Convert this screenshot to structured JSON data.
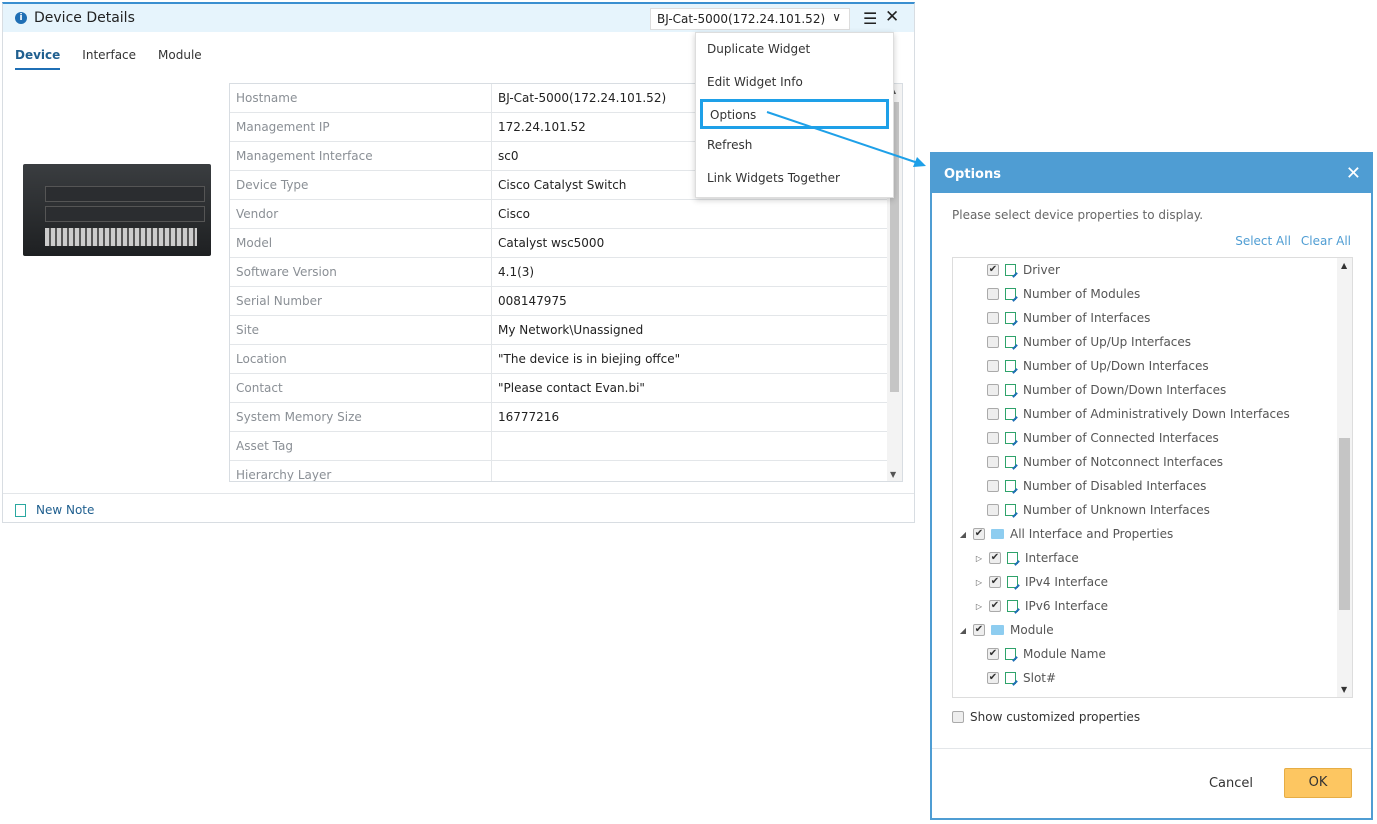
{
  "widget": {
    "title": "Device Details",
    "device_select": "BJ-Cat-5000(172.24.101.52)",
    "tabs": [
      {
        "label": "Device",
        "active": true
      },
      {
        "label": "Interface"
      },
      {
        "label": "Module"
      }
    ],
    "properties": [
      {
        "k": "Hostname",
        "v": "BJ-Cat-5000(172.24.101.52)"
      },
      {
        "k": "Management IP",
        "v": "172.24.101.52"
      },
      {
        "k": "Management Interface",
        "v": "sc0"
      },
      {
        "k": "Device Type",
        "v": "Cisco Catalyst Switch"
      },
      {
        "k": "Vendor",
        "v": "Cisco"
      },
      {
        "k": "Model",
        "v": "Catalyst wsc5000"
      },
      {
        "k": "Software Version",
        "v": "4.1(3)"
      },
      {
        "k": "Serial Number",
        "v": "008147975"
      },
      {
        "k": "Site",
        "v": "My Network\\Unassigned"
      },
      {
        "k": "Location",
        "v": "\"The device is in biejing offce\""
      },
      {
        "k": "Contact",
        "v": "\"Please contact Evan.bi\""
      },
      {
        "k": "System Memory Size",
        "v": "16777216"
      },
      {
        "k": "Asset Tag",
        "v": ""
      },
      {
        "k": "Hierarchy Layer",
        "v": ""
      }
    ],
    "new_note": "New Note"
  },
  "menu": [
    "Duplicate Widget",
    "Edit Widget Info",
    "Options",
    "Refresh",
    "Link Widgets Together"
  ],
  "dialog": {
    "title": "Options",
    "message": "Please select device properties to display.",
    "select_all": "Select All",
    "clear_all": "Clear All",
    "tree": [
      {
        "label": "Driver",
        "checked": true,
        "lvl": 2,
        "icon": "prop"
      },
      {
        "label": "Number of Modules",
        "checked": false,
        "lvl": 2,
        "icon": "prop"
      },
      {
        "label": "Number of Interfaces",
        "checked": false,
        "lvl": 2,
        "icon": "prop"
      },
      {
        "label": "Number of Up/Up Interfaces",
        "checked": false,
        "lvl": 2,
        "icon": "prop"
      },
      {
        "label": "Number of Up/Down Interfaces",
        "checked": false,
        "lvl": 2,
        "icon": "prop"
      },
      {
        "label": "Number of Down/Down Interfaces",
        "checked": false,
        "lvl": 2,
        "icon": "prop"
      },
      {
        "label": "Number of Administratively Down Interfaces",
        "checked": false,
        "lvl": 2,
        "icon": "prop"
      },
      {
        "label": "Number of Connected Interfaces",
        "checked": false,
        "lvl": 2,
        "icon": "prop"
      },
      {
        "label": "Number of Notconnect Interfaces",
        "checked": false,
        "lvl": 2,
        "icon": "prop"
      },
      {
        "label": "Number of Disabled Interfaces",
        "checked": false,
        "lvl": 2,
        "icon": "prop"
      },
      {
        "label": "Number of Unknown Interfaces",
        "checked": false,
        "lvl": 2,
        "icon": "prop"
      },
      {
        "label": "All Interface and Properties",
        "checked": true,
        "lvl": 0,
        "icon": "folder",
        "exp": "expanded"
      },
      {
        "label": "Interface",
        "checked": true,
        "lvl": 1,
        "icon": "prop",
        "exp": "collapsed"
      },
      {
        "label": "IPv4 Interface",
        "checked": true,
        "lvl": 1,
        "icon": "prop",
        "exp": "collapsed"
      },
      {
        "label": "IPv6 Interface",
        "checked": true,
        "lvl": 1,
        "icon": "prop",
        "exp": "collapsed"
      },
      {
        "label": "Module",
        "checked": true,
        "lvl": 0,
        "icon": "folder",
        "exp": "expanded"
      },
      {
        "label": "Module Name",
        "checked": true,
        "lvl": 2,
        "icon": "prop"
      },
      {
        "label": "Slot#",
        "checked": true,
        "lvl": 2,
        "icon": "prop"
      }
    ],
    "show_custom": "Show customized properties",
    "show_custom_checked": false,
    "cancel": "Cancel",
    "ok": "OK"
  },
  "colors": {
    "accent": "#4f9dd3",
    "highlight": "#1ea0e8",
    "ok_button": "#fdc661"
  }
}
